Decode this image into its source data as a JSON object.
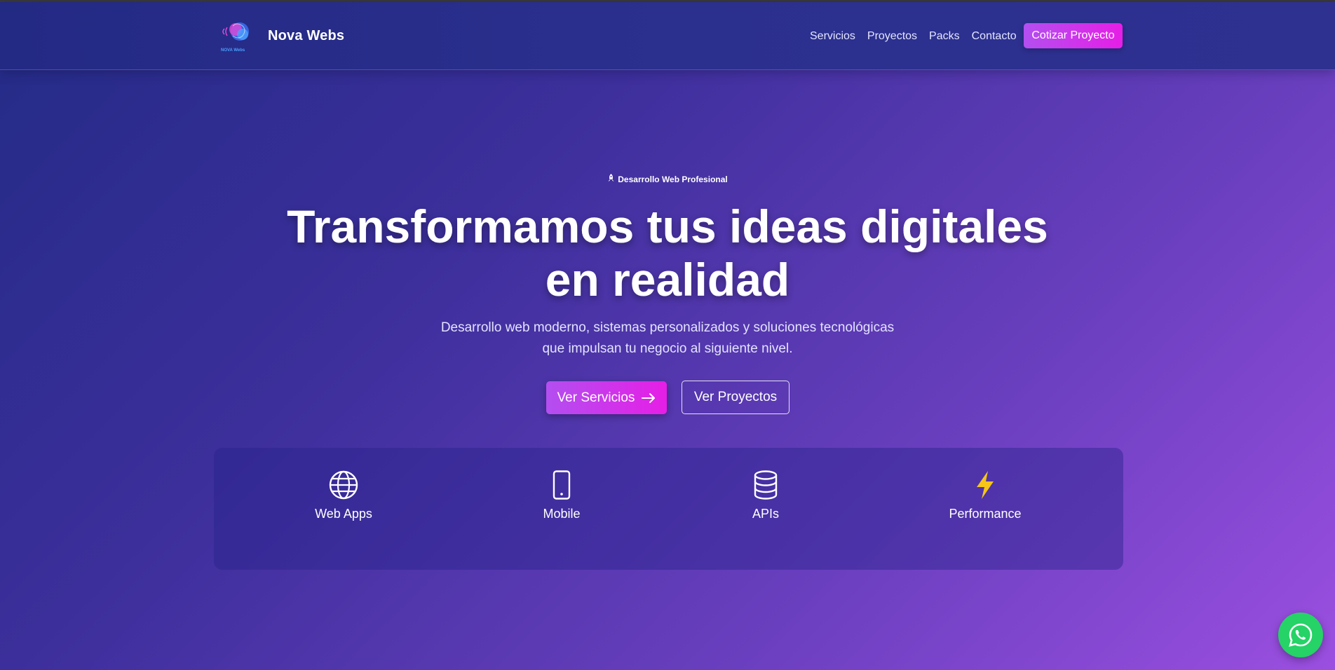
{
  "header": {
    "brand": "Nova Webs",
    "logo_text": "NOVA Webs",
    "nav": [
      "Servicios",
      "Proyectos",
      "Packs",
      "Contacto"
    ],
    "cta_label": "Cotizar Proyecto"
  },
  "hero": {
    "badge": "Desarrollo Web Profesional",
    "badge_icon": "rocket-icon",
    "title_line1": "Transformamos tus ideas digitales",
    "title_line2": "en realidad",
    "subtitle_line1": "Desarrollo web moderno, sistemas personalizados y soluciones tecnológicas",
    "subtitle_line2": "que impulsan tu negocio al siguiente nivel.",
    "primary_button": "Ver Servicios",
    "primary_button_icon": "arrow-right-icon",
    "secondary_button": "Ver Proyectos"
  },
  "features": [
    {
      "label": "Web Apps",
      "icon": "globe-icon"
    },
    {
      "label": "Mobile",
      "icon": "smartphone-icon"
    },
    {
      "label": "APIs",
      "icon": "database-icon"
    },
    {
      "label": "Performance",
      "icon": "lightning-icon"
    }
  ],
  "floating": {
    "icon": "whatsapp-icon"
  },
  "colors": {
    "accent_gradient_start": "#b34ff0",
    "accent_gradient_end": "#e61ee6",
    "lightning": "#f5c518",
    "whatsapp": "#25d366"
  }
}
